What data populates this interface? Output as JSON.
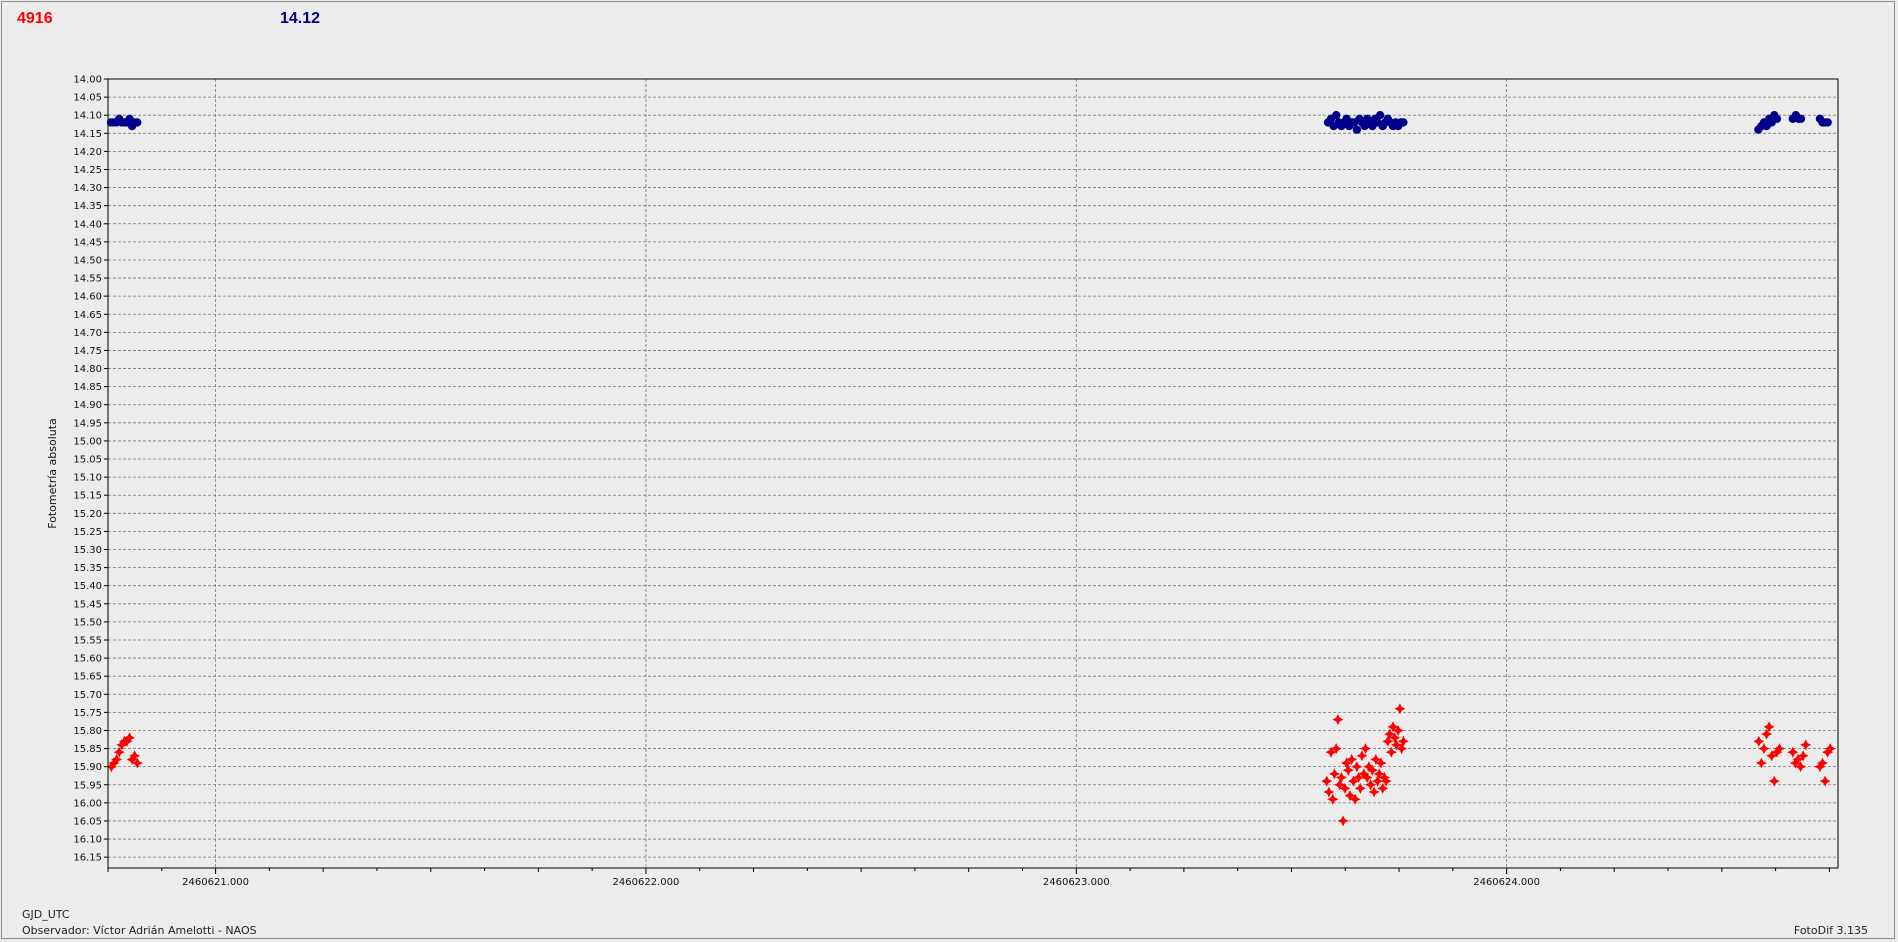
{
  "header": {
    "left_value": "4916",
    "left_color": "#ff0000",
    "right_value": "14.12",
    "right_color": "#00008b"
  },
  "footer": {
    "x_axis_name": "GJD_UTC",
    "observer": "Observador: Víctor Adrián Amelotti - NAOS",
    "version": "FotoDif 3.135"
  },
  "chart_data": {
    "type": "scatter",
    "title": "",
    "xlabel": "",
    "ylabel": "Fotometría absoluta",
    "xlim": [
      2460620.75,
      2460624.77
    ],
    "ylim": [
      14.0,
      16.18
    ],
    "y_inverted": true,
    "y_ticks": [
      "14.00",
      "14.05",
      "14.10",
      "14.15",
      "14.20",
      "14.25",
      "14.30",
      "14.35",
      "14.40",
      "14.45",
      "14.50",
      "14.55",
      "14.60",
      "14.65",
      "14.70",
      "14.75",
      "14.80",
      "14.85",
      "14.90",
      "14.95",
      "15.00",
      "15.05",
      "15.10",
      "15.15",
      "15.20",
      "15.25",
      "15.30",
      "15.35",
      "15.40",
      "15.45",
      "15.50",
      "15.55",
      "15.60",
      "15.65",
      "15.70",
      "15.75",
      "15.80",
      "15.85",
      "15.90",
      "15.95",
      "16.00",
      "16.05",
      "16.10",
      "16.15"
    ],
    "x_ticks": [
      {
        "value": 2460621.0,
        "label": "2460621.000"
      },
      {
        "value": 2460622.0,
        "label": "2460622.000"
      },
      {
        "value": 2460623.0,
        "label": "2460623.000"
      },
      {
        "value": 2460624.0,
        "label": "2460624.000"
      }
    ],
    "grid": true,
    "series": [
      {
        "color": "#00008b",
        "marker": "circle",
        "points": [
          [
            2460620.757,
            14.12
          ],
          [
            2460620.763,
            14.12
          ],
          [
            2460620.77,
            14.12
          ],
          [
            2460620.776,
            14.11
          ],
          [
            2460620.782,
            14.12
          ],
          [
            2460620.788,
            14.12
          ],
          [
            2460620.794,
            14.12
          ],
          [
            2460620.8,
            14.11
          ],
          [
            2460620.806,
            14.13
          ],
          [
            2460620.812,
            14.12
          ],
          [
            2460620.818,
            14.12
          ],
          [
            2460623.585,
            14.12
          ],
          [
            2460623.592,
            14.11
          ],
          [
            2460623.598,
            14.13
          ],
          [
            2460623.604,
            14.1
          ],
          [
            2460623.61,
            14.12
          ],
          [
            2460623.616,
            14.13
          ],
          [
            2460623.622,
            14.12
          ],
          [
            2460623.628,
            14.11
          ],
          [
            2460623.634,
            14.13
          ],
          [
            2460623.64,
            14.12
          ],
          [
            2460623.646,
            14.12
          ],
          [
            2460623.652,
            14.14
          ],
          [
            2460623.658,
            14.11
          ],
          [
            2460623.664,
            14.12
          ],
          [
            2460623.67,
            14.13
          ],
          [
            2460623.676,
            14.11
          ],
          [
            2460623.682,
            14.12
          ],
          [
            2460623.688,
            14.13
          ],
          [
            2460623.694,
            14.11
          ],
          [
            2460623.7,
            14.12
          ],
          [
            2460623.706,
            14.1
          ],
          [
            2460623.712,
            14.13
          ],
          [
            2460623.718,
            14.12
          ],
          [
            2460623.724,
            14.11
          ],
          [
            2460623.73,
            14.12
          ],
          [
            2460623.736,
            14.13
          ],
          [
            2460623.742,
            14.12
          ],
          [
            2460623.748,
            14.13
          ],
          [
            2460623.754,
            14.12
          ],
          [
            2460623.76,
            14.12
          ],
          [
            2460624.585,
            14.14
          ],
          [
            2460624.592,
            14.13
          ],
          [
            2460624.598,
            14.12
          ],
          [
            2460624.604,
            14.13
          ],
          [
            2460624.61,
            14.11
          ],
          [
            2460624.616,
            14.12
          ],
          [
            2460624.622,
            14.1
          ],
          [
            2460624.628,
            14.11
          ],
          [
            2460624.665,
            14.11
          ],
          [
            2460624.672,
            14.1
          ],
          [
            2460624.678,
            14.11
          ],
          [
            2460624.684,
            14.11
          ],
          [
            2460624.728,
            14.11
          ],
          [
            2460624.734,
            14.12
          ],
          [
            2460624.74,
            14.12
          ],
          [
            2460624.746,
            14.12
          ]
        ]
      },
      {
        "color": "#ff0000",
        "marker": "star",
        "points": [
          [
            2460620.758,
            15.9
          ],
          [
            2460620.764,
            15.89
          ],
          [
            2460620.77,
            15.88
          ],
          [
            2460620.776,
            15.86
          ],
          [
            2460620.782,
            15.84
          ],
          [
            2460620.788,
            15.83
          ],
          [
            2460620.794,
            15.83
          ],
          [
            2460620.8,
            15.82
          ],
          [
            2460620.806,
            15.88
          ],
          [
            2460620.812,
            15.87
          ],
          [
            2460620.818,
            15.89
          ],
          [
            2460623.582,
            15.94
          ],
          [
            2460623.587,
            15.97
          ],
          [
            2460623.592,
            15.86
          ],
          [
            2460623.596,
            15.99
          ],
          [
            2460623.6,
            15.92
          ],
          [
            2460623.604,
            15.85
          ],
          [
            2460623.608,
            15.77
          ],
          [
            2460623.612,
            15.95
          ],
          [
            2460623.616,
            15.93
          ],
          [
            2460623.62,
            16.05
          ],
          [
            2460623.624,
            15.96
          ],
          [
            2460623.628,
            15.89
          ],
          [
            2460623.632,
            15.91
          ],
          [
            2460623.636,
            15.98
          ],
          [
            2460623.64,
            15.88
          ],
          [
            2460623.644,
            15.94
          ],
          [
            2460623.648,
            15.99
          ],
          [
            2460623.652,
            15.9
          ],
          [
            2460623.656,
            15.93
          ],
          [
            2460623.66,
            15.96
          ],
          [
            2460623.664,
            15.87
          ],
          [
            2460623.668,
            15.92
          ],
          [
            2460623.672,
            15.85
          ],
          [
            2460623.676,
            15.93
          ],
          [
            2460623.68,
            15.9
          ],
          [
            2460623.684,
            15.95
          ],
          [
            2460623.688,
            15.91
          ],
          [
            2460623.692,
            15.97
          ],
          [
            2460623.696,
            15.88
          ],
          [
            2460623.7,
            15.94
          ],
          [
            2460623.704,
            15.92
          ],
          [
            2460623.708,
            15.89
          ],
          [
            2460623.712,
            15.96
          ],
          [
            2460623.716,
            15.93
          ],
          [
            2460623.72,
            15.94
          ],
          [
            2460623.724,
            15.83
          ],
          [
            2460623.728,
            15.81
          ],
          [
            2460623.732,
            15.86
          ],
          [
            2460623.736,
            15.79
          ],
          [
            2460623.74,
            15.82
          ],
          [
            2460623.744,
            15.84
          ],
          [
            2460623.748,
            15.8
          ],
          [
            2460623.752,
            15.74
          ],
          [
            2460623.756,
            15.85
          ],
          [
            2460623.76,
            15.83
          ],
          [
            2460624.586,
            15.83
          ],
          [
            2460624.592,
            15.89
          ],
          [
            2460624.598,
            15.85
          ],
          [
            2460624.604,
            15.81
          ],
          [
            2460624.61,
            15.79
          ],
          [
            2460624.616,
            15.87
          ],
          [
            2460624.622,
            15.94
          ],
          [
            2460624.628,
            15.86
          ],
          [
            2460624.634,
            15.85
          ],
          [
            2460624.665,
            15.86
          ],
          [
            2460624.671,
            15.89
          ],
          [
            2460624.677,
            15.88
          ],
          [
            2460624.683,
            15.9
          ],
          [
            2460624.689,
            15.87
          ],
          [
            2460624.695,
            15.84
          ],
          [
            2460624.728,
            15.9
          ],
          [
            2460624.734,
            15.89
          ],
          [
            2460624.74,
            15.94
          ],
          [
            2460624.746,
            15.86
          ],
          [
            2460624.752,
            15.85
          ]
        ]
      }
    ]
  }
}
